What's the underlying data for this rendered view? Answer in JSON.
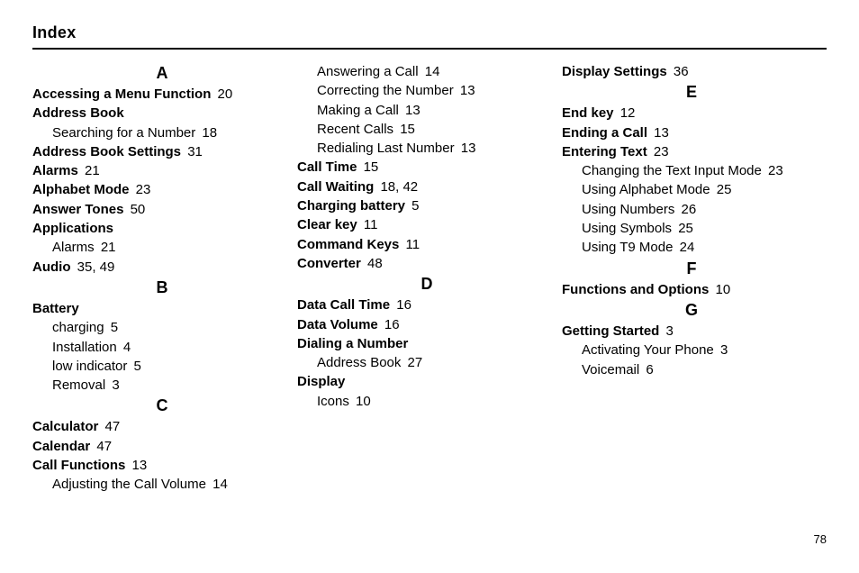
{
  "title": "Index",
  "page_number": "78",
  "columns": [
    {
      "blocks": [
        {
          "type": "letter",
          "text": "A"
        },
        {
          "type": "entry",
          "bold": true,
          "label": "Accessing a Menu Function",
          "page": "20"
        },
        {
          "type": "entry",
          "bold": true,
          "label": "Address Book"
        },
        {
          "type": "sub",
          "label": "Searching for a Number",
          "page": "18"
        },
        {
          "type": "entry",
          "bold": true,
          "label": "Address Book Settings",
          "page": "31"
        },
        {
          "type": "entry",
          "bold": true,
          "label": "Alarms",
          "page": "21"
        },
        {
          "type": "entry",
          "bold": true,
          "label": "Alphabet Mode",
          "page": "23"
        },
        {
          "type": "entry",
          "bold": true,
          "label": "Answer Tones",
          "page": "50"
        },
        {
          "type": "entry",
          "bold": true,
          "label": "Applications"
        },
        {
          "type": "sub",
          "label": "Alarms",
          "page": "21"
        },
        {
          "type": "entry",
          "bold": true,
          "label": "Audio",
          "page": "35, 49"
        },
        {
          "type": "letter",
          "text": "B"
        },
        {
          "type": "entry",
          "bold": true,
          "label": "Battery"
        },
        {
          "type": "sub",
          "label": "charging",
          "page": "5"
        },
        {
          "type": "sub",
          "label": "Installation",
          "page": "4"
        },
        {
          "type": "sub",
          "label": "low indicator",
          "page": "5"
        },
        {
          "type": "sub",
          "label": "Removal",
          "page": "3"
        },
        {
          "type": "letter",
          "text": "C"
        },
        {
          "type": "entry",
          "bold": true,
          "label": "Calculator",
          "page": "47"
        },
        {
          "type": "entry",
          "bold": true,
          "label": "Calendar",
          "page": "47"
        },
        {
          "type": "entry",
          "bold": true,
          "label": "Call Functions",
          "page": "13"
        },
        {
          "type": "sub",
          "label": "Adjusting the Call Volume",
          "page": "14"
        }
      ]
    },
    {
      "blocks": [
        {
          "type": "sub",
          "label": "Answering a Call",
          "page": "14"
        },
        {
          "type": "sub",
          "label": "Correcting the Number",
          "page": "13"
        },
        {
          "type": "sub",
          "label": "Making a Call",
          "page": "13"
        },
        {
          "type": "sub",
          "label": "Recent Calls",
          "page": "15"
        },
        {
          "type": "sub",
          "label": "Redialing Last Number",
          "page": "13"
        },
        {
          "type": "entry",
          "bold": true,
          "label": "Call Time",
          "page": "15"
        },
        {
          "type": "entry",
          "bold": true,
          "label": "Call Waiting",
          "page": "18, 42"
        },
        {
          "type": "entry",
          "bold": true,
          "label": "Charging battery",
          "page": "5"
        },
        {
          "type": "entry",
          "bold": true,
          "label": "Clear key",
          "page": "11"
        },
        {
          "type": "entry",
          "bold": true,
          "label": "Command Keys",
          "page": "11"
        },
        {
          "type": "entry",
          "bold": true,
          "label": "Converter",
          "page": "48"
        },
        {
          "type": "letter",
          "text": "D"
        },
        {
          "type": "entry",
          "bold": true,
          "label": "Data Call Time",
          "page": "16"
        },
        {
          "type": "entry",
          "bold": true,
          "label": "Data Volume",
          "page": "16"
        },
        {
          "type": "entry",
          "bold": true,
          "label": "Dialing a Number"
        },
        {
          "type": "sub",
          "label": "Address Book",
          "page": "27"
        },
        {
          "type": "entry",
          "bold": true,
          "label": "Display"
        },
        {
          "type": "sub",
          "label": "Icons",
          "page": "10"
        }
      ]
    },
    {
      "blocks": [
        {
          "type": "entry",
          "bold": true,
          "label": "Display Settings",
          "page": "36"
        },
        {
          "type": "letter",
          "text": "E"
        },
        {
          "type": "entry",
          "bold": true,
          "label": "End key",
          "page": "12"
        },
        {
          "type": "entry",
          "bold": true,
          "label": "Ending a Call",
          "page": "13"
        },
        {
          "type": "entry",
          "bold": true,
          "label": "Entering Text",
          "page": "23"
        },
        {
          "type": "sub",
          "label": "Changing the Text Input Mode",
          "page": "23"
        },
        {
          "type": "sub",
          "label": "Using Alphabet Mode",
          "page": "25"
        },
        {
          "type": "sub",
          "label": "Using Numbers",
          "page": "26"
        },
        {
          "type": "sub",
          "label": "Using Symbols",
          "page": "25"
        },
        {
          "type": "sub",
          "label": "Using T9 Mode",
          "page": "24"
        },
        {
          "type": "letter",
          "text": "F"
        },
        {
          "type": "entry",
          "bold": true,
          "label": "Functions and Options",
          "page": "10"
        },
        {
          "type": "letter",
          "text": "G"
        },
        {
          "type": "entry",
          "bold": true,
          "label": "Getting Started",
          "page": "3"
        },
        {
          "type": "sub",
          "label": "Activating Your Phone",
          "page": "3"
        },
        {
          "type": "sub",
          "label": "Voicemail",
          "page": "6"
        }
      ]
    }
  ]
}
